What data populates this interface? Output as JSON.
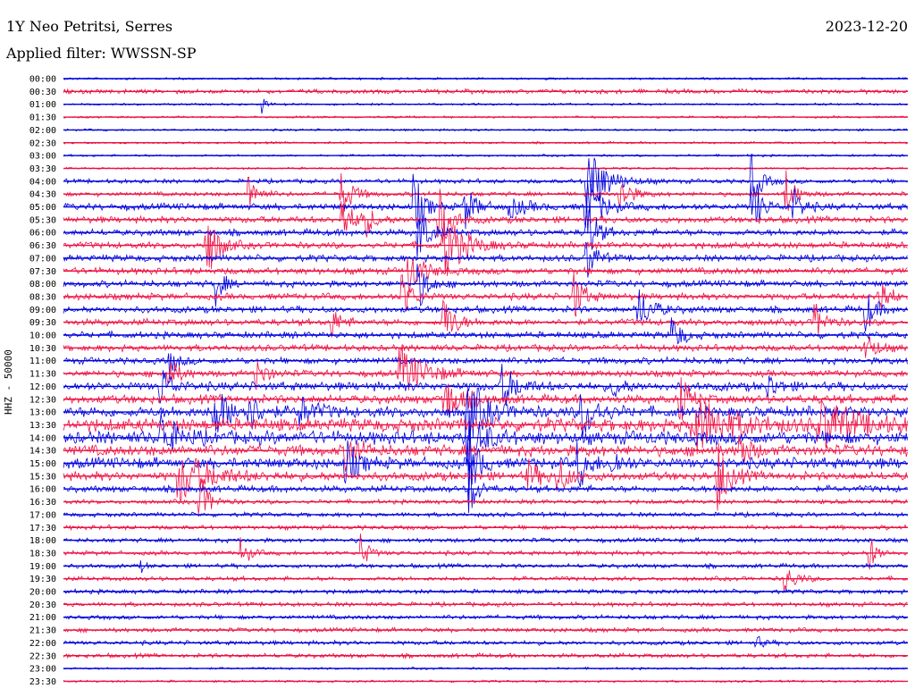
{
  "header": {
    "station": "1Y Neo Petritsi, Serres",
    "date": "2023-12-20",
    "filter": "Applied filter: WWSSN-SP"
  },
  "chart_data": {
    "type": "line",
    "title": "1Y Neo Petritsi, Serres",
    "subtitle": "Applied filter: WWSSN-SP",
    "ylabel": "HHZ - 50000",
    "xlabel": "",
    "grid": false,
    "row_labels": [
      "00:00",
      "00:30",
      "01:00",
      "01:30",
      "02:00",
      "02:30",
      "03:00",
      "03:30",
      "04:00",
      "04:30",
      "05:00",
      "05:30",
      "06:00",
      "06:30",
      "07:00",
      "07:30",
      "08:00",
      "08:30",
      "09:00",
      "09:30",
      "10:00",
      "10:30",
      "11:00",
      "11:30",
      "12:00",
      "12:30",
      "13:00",
      "13:30",
      "14:00",
      "14:30",
      "15:00",
      "15:30",
      "16:00",
      "16:30",
      "17:00",
      "17:30",
      "18:00",
      "18:30",
      "19:00",
      "19:30",
      "20:00",
      "20:30",
      "21:00",
      "21:30",
      "22:00",
      "22:30",
      "23:00",
      "23:30"
    ],
    "series_colors": [
      "#0000dd",
      "#ee1144"
    ],
    "noise_level": [
      1,
      2,
      1,
      1,
      1,
      1,
      1,
      1,
      2,
      2,
      3,
      3,
      3,
      3,
      3,
      3,
      3,
      3,
      3,
      3,
      3,
      3,
      3,
      3,
      4,
      4,
      5,
      6,
      6,
      5,
      5,
      4,
      3,
      2,
      2,
      2,
      2,
      2,
      2,
      2,
      2,
      2,
      2,
      2,
      2,
      2,
      1,
      1
    ],
    "events": [
      {
        "row": 2,
        "x": 0.235,
        "amp": 12,
        "width": 0.004
      },
      {
        "row": 8,
        "x": 0.62,
        "amp": 45,
        "width": 0.02
      },
      {
        "row": 8,
        "x": 0.815,
        "amp": 30,
        "width": 0.01
      },
      {
        "row": 9,
        "x": 0.22,
        "amp": 22,
        "width": 0.01
      },
      {
        "row": 9,
        "x": 0.33,
        "amp": 25,
        "width": 0.012
      },
      {
        "row": 9,
        "x": 0.66,
        "amp": 20,
        "width": 0.012
      },
      {
        "row": 9,
        "x": 0.855,
        "amp": 28,
        "width": 0.01
      },
      {
        "row": 10,
        "x": 0.415,
        "amp": 40,
        "width": 0.01
      },
      {
        "row": 10,
        "x": 0.475,
        "amp": 25,
        "width": 0.012
      },
      {
        "row": 10,
        "x": 0.53,
        "amp": 10,
        "width": 0.02
      },
      {
        "row": 10,
        "x": 0.62,
        "amp": 35,
        "width": 0.015
      },
      {
        "row": 10,
        "x": 0.815,
        "amp": 35,
        "width": 0.01
      },
      {
        "row": 10,
        "x": 0.865,
        "amp": 20,
        "width": 0.01
      },
      {
        "row": 11,
        "x": 0.33,
        "amp": 30,
        "width": 0.01
      },
      {
        "row": 11,
        "x": 0.355,
        "amp": 22,
        "width": 0.01
      },
      {
        "row": 11,
        "x": 0.445,
        "amp": 35,
        "width": 0.012
      },
      {
        "row": 12,
        "x": 0.42,
        "amp": 40,
        "width": 0.01
      },
      {
        "row": 12,
        "x": 0.62,
        "amp": 40,
        "width": 0.01
      },
      {
        "row": 13,
        "x": 0.17,
        "amp": 40,
        "width": 0.012
      },
      {
        "row": 13,
        "x": 0.45,
        "amp": 45,
        "width": 0.02
      },
      {
        "row": 14,
        "x": 0.62,
        "amp": 25,
        "width": 0.01
      },
      {
        "row": 15,
        "x": 0.41,
        "amp": 25,
        "width": 0.015
      },
      {
        "row": 16,
        "x": 0.18,
        "amp": 25,
        "width": 0.008
      },
      {
        "row": 16,
        "x": 0.42,
        "amp": 30,
        "width": 0.01
      },
      {
        "row": 17,
        "x": 0.4,
        "amp": 30,
        "width": 0.01
      },
      {
        "row": 17,
        "x": 0.605,
        "amp": 30,
        "width": 0.01
      },
      {
        "row": 17,
        "x": 0.965,
        "amp": 30,
        "width": 0.01
      },
      {
        "row": 18,
        "x": 0.68,
        "amp": 25,
        "width": 0.015
      },
      {
        "row": 18,
        "x": 0.95,
        "amp": 25,
        "width": 0.01
      },
      {
        "row": 19,
        "x": 0.315,
        "amp": 22,
        "width": 0.01
      },
      {
        "row": 19,
        "x": 0.45,
        "amp": 30,
        "width": 0.012
      },
      {
        "row": 19,
        "x": 0.89,
        "amp": 22,
        "width": 0.01
      },
      {
        "row": 20,
        "x": 0.72,
        "amp": 25,
        "width": 0.01
      },
      {
        "row": 21,
        "x": 0.95,
        "amp": 20,
        "width": 0.01
      },
      {
        "row": 22,
        "x": 0.125,
        "amp": 20,
        "width": 0.008
      },
      {
        "row": 23,
        "x": 0.125,
        "amp": 20,
        "width": 0.01
      },
      {
        "row": 23,
        "x": 0.228,
        "amp": 20,
        "width": 0.01
      },
      {
        "row": 23,
        "x": 0.4,
        "amp": 30,
        "width": 0.025
      },
      {
        "row": 24,
        "x": 0.115,
        "amp": 25,
        "width": 0.01
      },
      {
        "row": 24,
        "x": 0.52,
        "amp": 25,
        "width": 0.015
      },
      {
        "row": 24,
        "x": 0.65,
        "amp": 15,
        "width": 0.01
      },
      {
        "row": 24,
        "x": 0.835,
        "amp": 15,
        "width": 0.01
      },
      {
        "row": 25,
        "x": 0.45,
        "amp": 25,
        "width": 0.02
      },
      {
        "row": 25,
        "x": 0.73,
        "amp": 30,
        "width": 0.01
      },
      {
        "row": 26,
        "x": 0.18,
        "amp": 25,
        "width": 0.02
      },
      {
        "row": 26,
        "x": 0.22,
        "amp": 20,
        "width": 0.01
      },
      {
        "row": 26,
        "x": 0.28,
        "amp": 18,
        "width": 0.015
      },
      {
        "row": 26,
        "x": 0.48,
        "amp": 35,
        "width": 0.02
      },
      {
        "row": 26,
        "x": 0.615,
        "amp": 30,
        "width": 0.015
      },
      {
        "row": 27,
        "x": 0.75,
        "amp": 30,
        "width": 0.04
      },
      {
        "row": 27,
        "x": 0.9,
        "amp": 25,
        "width": 0.04
      },
      {
        "row": 28,
        "x": 0.115,
        "amp": 30,
        "width": 0.015
      },
      {
        "row": 28,
        "x": 0.48,
        "amp": 40,
        "width": 0.015
      },
      {
        "row": 29,
        "x": 0.335,
        "amp": 18,
        "width": 0.015
      },
      {
        "row": 29,
        "x": 0.8,
        "amp": 25,
        "width": 0.01
      },
      {
        "row": 30,
        "x": 0.335,
        "amp": 25,
        "width": 0.012
      },
      {
        "row": 30,
        "x": 0.48,
        "amp": 45,
        "width": 0.01
      },
      {
        "row": 30,
        "x": 0.61,
        "amp": 30,
        "width": 0.01
      },
      {
        "row": 30,
        "x": 0.65,
        "amp": 15,
        "width": 0.01
      },
      {
        "row": 31,
        "x": 0.14,
        "amp": 30,
        "width": 0.03
      },
      {
        "row": 31,
        "x": 0.55,
        "amp": 18,
        "width": 0.012
      },
      {
        "row": 31,
        "x": 0.585,
        "amp": 20,
        "width": 0.012
      },
      {
        "row": 31,
        "x": 0.775,
        "amp": 40,
        "width": 0.012
      },
      {
        "row": 32,
        "x": 0.48,
        "amp": 40,
        "width": 0.008
      },
      {
        "row": 33,
        "x": 0.16,
        "amp": 35,
        "width": 0.01
      },
      {
        "row": 37,
        "x": 0.21,
        "amp": 20,
        "width": 0.008
      },
      {
        "row": 37,
        "x": 0.352,
        "amp": 22,
        "width": 0.008
      },
      {
        "row": 37,
        "x": 0.955,
        "amp": 22,
        "width": 0.008
      },
      {
        "row": 38,
        "x": 0.092,
        "amp": 6,
        "width": 0.004
      },
      {
        "row": 39,
        "x": 0.855,
        "amp": 15,
        "width": 0.012
      },
      {
        "row": 44,
        "x": 0.82,
        "amp": 8,
        "width": 0.008
      }
    ]
  }
}
